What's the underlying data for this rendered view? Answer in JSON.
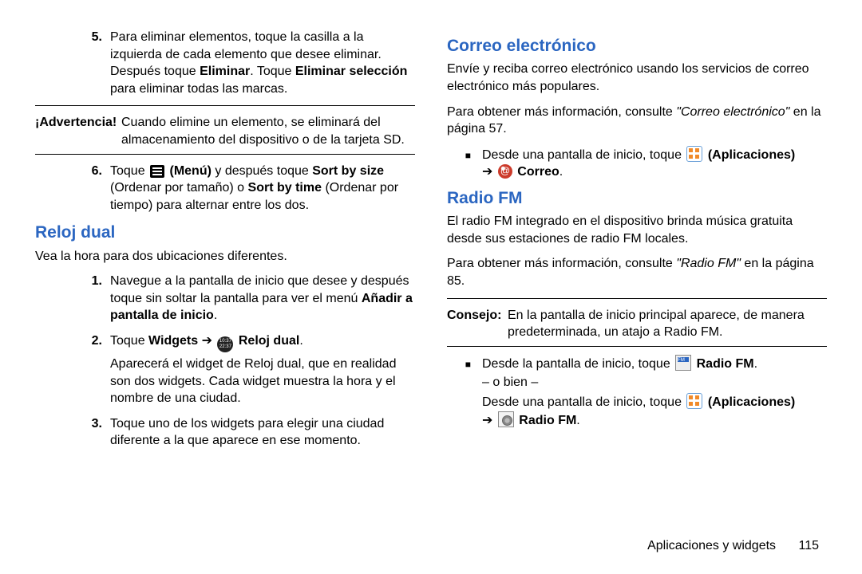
{
  "left": {
    "step5": {
      "num": "5.",
      "p1a": "Para eliminar elementos, toque la casilla a la izquierda de cada elemento que desee eliminar. Después toque ",
      "b1": "Eliminar",
      "p1b": ". Toque ",
      "b2": "Eliminar selección",
      "p1c": " para eliminar todas las marcas."
    },
    "warning": {
      "label": "¡Advertencia!",
      "text": "Cuando elimine un elemento, se eliminará del almacenamiento del dispositivo o de la tarjeta SD."
    },
    "step6": {
      "num": "6.",
      "a": "Toque ",
      "menu_b": " (Menú)",
      "b": " y después toque ",
      "sort_size_b": "Sort by size",
      "sort_size_paren": " (Ordenar por tamaño) o ",
      "sort_time_b": "Sort by time",
      "sort_time_paren": " (Ordenar por tiempo) para alternar entre los dos."
    },
    "h_reloj": "Reloj dual",
    "reloj_intro": "Vea la hora para dos ubicaciones diferentes.",
    "r1": {
      "num": "1.",
      "a": "Navegue a la pantalla de inicio que desee y después toque sin soltar la pantalla para ver el menú ",
      "b": "Añadir a pantalla de inicio",
      "c": "."
    },
    "r2": {
      "num": "2.",
      "a": "Toque ",
      "widgets_b": "Widgets",
      "arrow": " ➔ ",
      "reloj_b": " Reloj dual",
      "c": ".",
      "p2": "Aparecerá el widget de Reloj dual, que en realidad son dos widgets. Cada widget muestra la hora y el nombre de una ciudad."
    },
    "r3": {
      "num": "3.",
      "text": "Toque uno de los widgets para elegir una ciudad diferente a la que aparece en ese momento."
    },
    "clock_top": "10:37",
    "clock_bot": "22:37"
  },
  "right": {
    "h_correo": "Correo electrónico",
    "correo_intro": "Envíe y reciba correo electrónico usando los servicios de correo electrónico más populares.",
    "correo_info_a": "Para obtener más información, consulte ",
    "correo_info_i": "\"Correo electrónico\"",
    "correo_info_b": " en la página 57.",
    "bullet_correo": {
      "a": "Desde una pantalla de inicio, toque ",
      "apps_b": " (Aplicaciones)",
      "arrow": " ➔ ",
      "correo_b": " Correo",
      "c": "."
    },
    "h_radio": "Radio FM",
    "radio_intro": "El radio FM integrado en el dispositivo brinda música gratuita desde sus estaciones de radio FM locales.",
    "radio_info_a": "Para obtener más información, consulte ",
    "radio_info_i": "\"Radio FM\"",
    "radio_info_b": " en la página 85.",
    "consejo": {
      "label": "Consejo:",
      "text": "En la pantalla de inicio principal aparece, de manera predeterminada, un atajo a Radio FM."
    },
    "bullet_radio": {
      "a": "Desde la pantalla de inicio, toque ",
      "home_b": " Radio FM",
      "c": ".",
      "or": "– o bien –",
      "d": "Desde una pantalla de inicio, toque ",
      "apps_b": " (Aplicaciones)",
      "arrow": " ➔ ",
      "app_b": " Radio FM",
      "e": "."
    }
  },
  "footer": {
    "section": "Aplicaciones y widgets",
    "page": "115"
  }
}
